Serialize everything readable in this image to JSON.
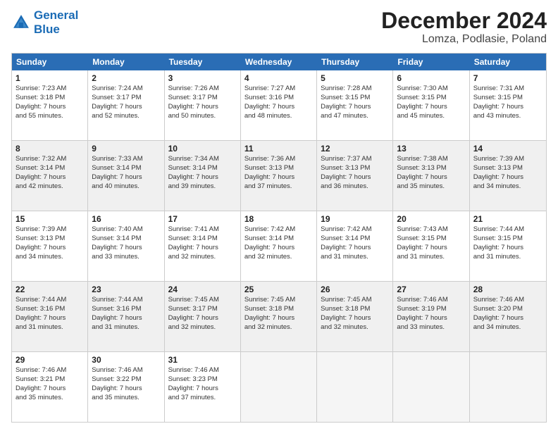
{
  "header": {
    "logo_line1": "General",
    "logo_line2": "Blue",
    "title": "December 2024",
    "subtitle": "Lomza, Podlasie, Poland"
  },
  "weekdays": [
    "Sunday",
    "Monday",
    "Tuesday",
    "Wednesday",
    "Thursday",
    "Friday",
    "Saturday"
  ],
  "weeks": [
    [
      {
        "day": "1",
        "info": "Sunrise: 7:23 AM\nSunset: 3:18 PM\nDaylight: 7 hours\nand 55 minutes.",
        "shaded": false
      },
      {
        "day": "2",
        "info": "Sunrise: 7:24 AM\nSunset: 3:17 PM\nDaylight: 7 hours\nand 52 minutes.",
        "shaded": false
      },
      {
        "day": "3",
        "info": "Sunrise: 7:26 AM\nSunset: 3:17 PM\nDaylight: 7 hours\nand 50 minutes.",
        "shaded": false
      },
      {
        "day": "4",
        "info": "Sunrise: 7:27 AM\nSunset: 3:16 PM\nDaylight: 7 hours\nand 48 minutes.",
        "shaded": false
      },
      {
        "day": "5",
        "info": "Sunrise: 7:28 AM\nSunset: 3:15 PM\nDaylight: 7 hours\nand 47 minutes.",
        "shaded": false
      },
      {
        "day": "6",
        "info": "Sunrise: 7:30 AM\nSunset: 3:15 PM\nDaylight: 7 hours\nand 45 minutes.",
        "shaded": false
      },
      {
        "day": "7",
        "info": "Sunrise: 7:31 AM\nSunset: 3:15 PM\nDaylight: 7 hours\nand 43 minutes.",
        "shaded": false
      }
    ],
    [
      {
        "day": "8",
        "info": "Sunrise: 7:32 AM\nSunset: 3:14 PM\nDaylight: 7 hours\nand 42 minutes.",
        "shaded": true
      },
      {
        "day": "9",
        "info": "Sunrise: 7:33 AM\nSunset: 3:14 PM\nDaylight: 7 hours\nand 40 minutes.",
        "shaded": true
      },
      {
        "day": "10",
        "info": "Sunrise: 7:34 AM\nSunset: 3:14 PM\nDaylight: 7 hours\nand 39 minutes.",
        "shaded": true
      },
      {
        "day": "11",
        "info": "Sunrise: 7:36 AM\nSunset: 3:13 PM\nDaylight: 7 hours\nand 37 minutes.",
        "shaded": true
      },
      {
        "day": "12",
        "info": "Sunrise: 7:37 AM\nSunset: 3:13 PM\nDaylight: 7 hours\nand 36 minutes.",
        "shaded": true
      },
      {
        "day": "13",
        "info": "Sunrise: 7:38 AM\nSunset: 3:13 PM\nDaylight: 7 hours\nand 35 minutes.",
        "shaded": true
      },
      {
        "day": "14",
        "info": "Sunrise: 7:39 AM\nSunset: 3:13 PM\nDaylight: 7 hours\nand 34 minutes.",
        "shaded": true
      }
    ],
    [
      {
        "day": "15",
        "info": "Sunrise: 7:39 AM\nSunset: 3:13 PM\nDaylight: 7 hours\nand 34 minutes.",
        "shaded": false
      },
      {
        "day": "16",
        "info": "Sunrise: 7:40 AM\nSunset: 3:14 PM\nDaylight: 7 hours\nand 33 minutes.",
        "shaded": false
      },
      {
        "day": "17",
        "info": "Sunrise: 7:41 AM\nSunset: 3:14 PM\nDaylight: 7 hours\nand 32 minutes.",
        "shaded": false
      },
      {
        "day": "18",
        "info": "Sunrise: 7:42 AM\nSunset: 3:14 PM\nDaylight: 7 hours\nand 32 minutes.",
        "shaded": false
      },
      {
        "day": "19",
        "info": "Sunrise: 7:42 AM\nSunset: 3:14 PM\nDaylight: 7 hours\nand 31 minutes.",
        "shaded": false
      },
      {
        "day": "20",
        "info": "Sunrise: 7:43 AM\nSunset: 3:15 PM\nDaylight: 7 hours\nand 31 minutes.",
        "shaded": false
      },
      {
        "day": "21",
        "info": "Sunrise: 7:44 AM\nSunset: 3:15 PM\nDaylight: 7 hours\nand 31 minutes.",
        "shaded": false
      }
    ],
    [
      {
        "day": "22",
        "info": "Sunrise: 7:44 AM\nSunset: 3:16 PM\nDaylight: 7 hours\nand 31 minutes.",
        "shaded": true
      },
      {
        "day": "23",
        "info": "Sunrise: 7:44 AM\nSunset: 3:16 PM\nDaylight: 7 hours\nand 31 minutes.",
        "shaded": true
      },
      {
        "day": "24",
        "info": "Sunrise: 7:45 AM\nSunset: 3:17 PM\nDaylight: 7 hours\nand 32 minutes.",
        "shaded": true
      },
      {
        "day": "25",
        "info": "Sunrise: 7:45 AM\nSunset: 3:18 PM\nDaylight: 7 hours\nand 32 minutes.",
        "shaded": true
      },
      {
        "day": "26",
        "info": "Sunrise: 7:45 AM\nSunset: 3:18 PM\nDaylight: 7 hours\nand 32 minutes.",
        "shaded": true
      },
      {
        "day": "27",
        "info": "Sunrise: 7:46 AM\nSunset: 3:19 PM\nDaylight: 7 hours\nand 33 minutes.",
        "shaded": true
      },
      {
        "day": "28",
        "info": "Sunrise: 7:46 AM\nSunset: 3:20 PM\nDaylight: 7 hours\nand 34 minutes.",
        "shaded": true
      }
    ],
    [
      {
        "day": "29",
        "info": "Sunrise: 7:46 AM\nSunset: 3:21 PM\nDaylight: 7 hours\nand 35 minutes.",
        "shaded": false
      },
      {
        "day": "30",
        "info": "Sunrise: 7:46 AM\nSunset: 3:22 PM\nDaylight: 7 hours\nand 35 minutes.",
        "shaded": false
      },
      {
        "day": "31",
        "info": "Sunrise: 7:46 AM\nSunset: 3:23 PM\nDaylight: 7 hours\nand 37 minutes.",
        "shaded": false
      },
      {
        "day": "",
        "info": "",
        "shaded": true,
        "empty": true
      },
      {
        "day": "",
        "info": "",
        "shaded": true,
        "empty": true
      },
      {
        "day": "",
        "info": "",
        "shaded": true,
        "empty": true
      },
      {
        "day": "",
        "info": "",
        "shaded": true,
        "empty": true
      }
    ]
  ]
}
